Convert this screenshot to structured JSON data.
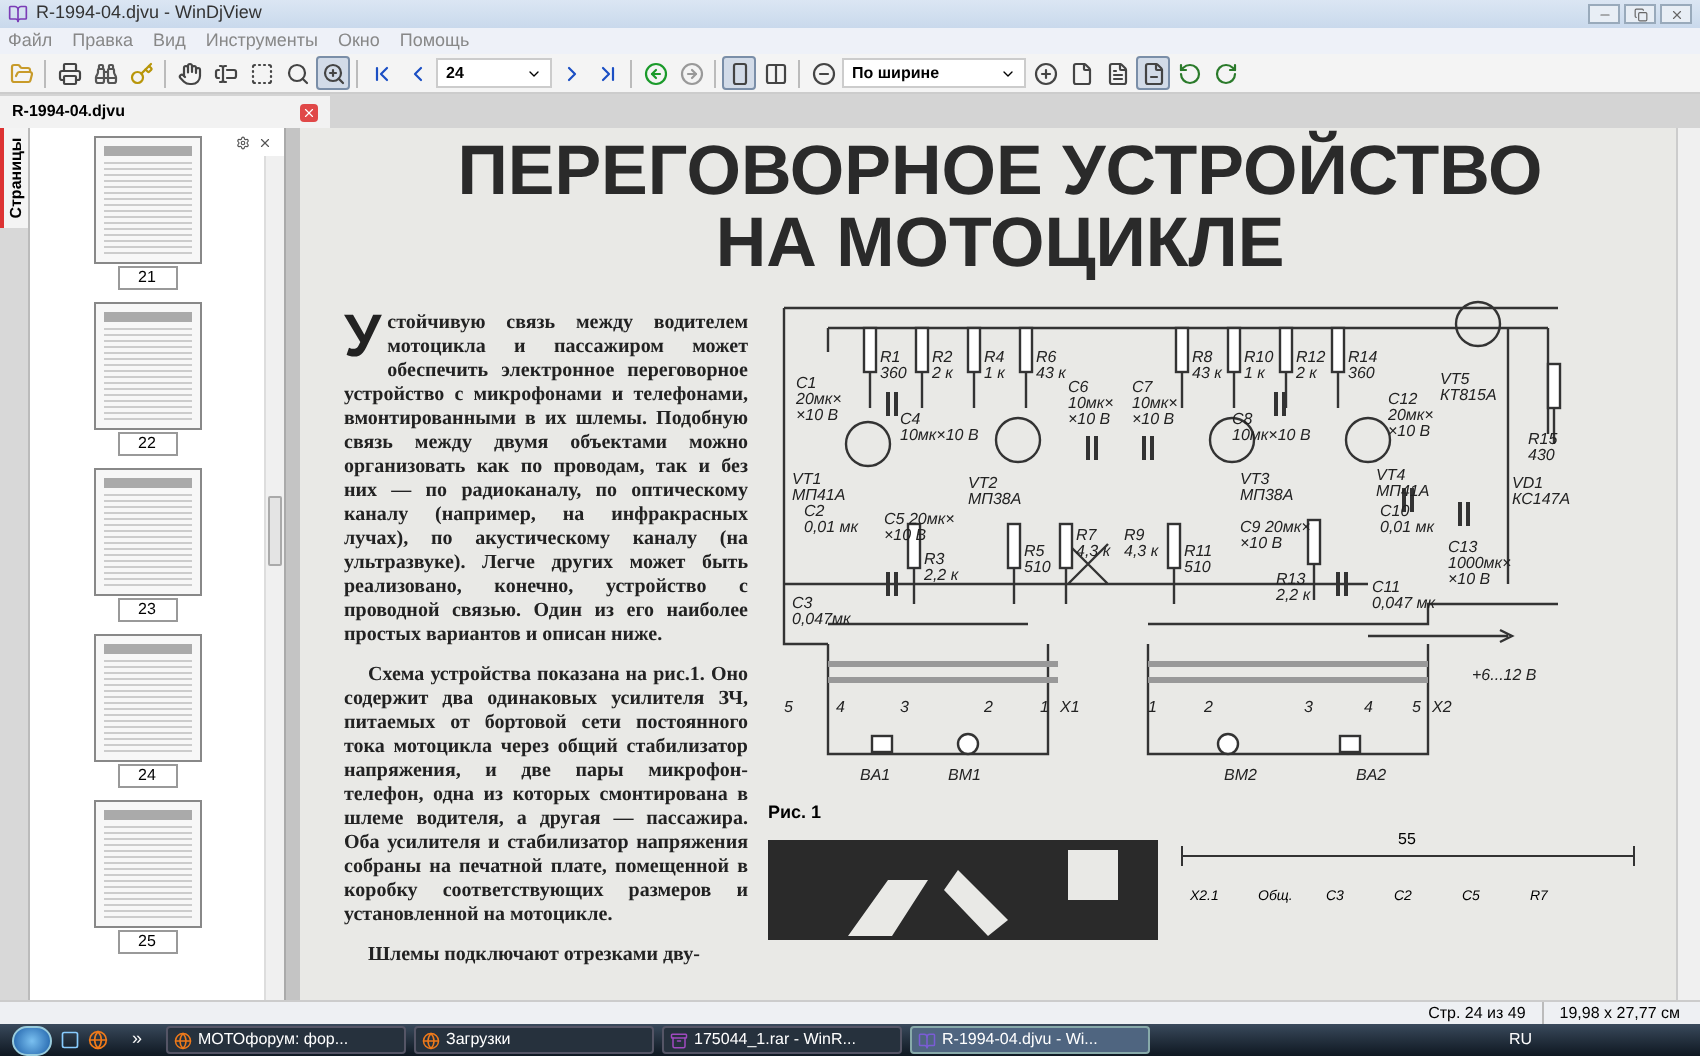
{
  "window": {
    "title": "R-1994-04.djvu - WinDjView"
  },
  "menu": [
    "Файл",
    "Правка",
    "Вид",
    "Инструменты",
    "Окно",
    "Помощь"
  ],
  "toolbar": [
    {
      "kind": "open",
      "selected": false
    },
    {
      "kind": "separator"
    },
    {
      "kind": "print",
      "selected": false
    },
    {
      "kind": "find",
      "selected": false
    },
    {
      "kind": "properties",
      "selected": false
    },
    {
      "kind": "separator"
    },
    {
      "kind": "hand",
      "selected": false
    },
    {
      "kind": "text-select",
      "selected": false
    },
    {
      "kind": "rect-select",
      "selected": false
    },
    {
      "kind": "zoom",
      "selected": false
    },
    {
      "kind": "zoom-rect",
      "selected": true
    },
    {
      "kind": "separator"
    },
    {
      "kind": "first",
      "selected": false
    },
    {
      "kind": "prev",
      "selected": false
    },
    {
      "kind": "page-field",
      "value": "24"
    },
    {
      "kind": "next",
      "selected": false
    },
    {
      "kind": "last",
      "selected": false
    },
    {
      "kind": "separator"
    },
    {
      "kind": "back",
      "selected": false
    },
    {
      "kind": "forward",
      "selected": false
    },
    {
      "kind": "separator"
    },
    {
      "kind": "single-page",
      "selected": true
    },
    {
      "kind": "two-pages",
      "selected": false
    },
    {
      "kind": "separator"
    },
    {
      "kind": "zoom-out",
      "selected": false
    },
    {
      "kind": "zoom-combo",
      "value": "По ширине"
    },
    {
      "kind": "zoom-in",
      "selected": false
    },
    {
      "kind": "fit-page",
      "selected": false
    },
    {
      "kind": "fit-width",
      "selected": false
    },
    {
      "kind": "actual-size",
      "selected": true
    },
    {
      "kind": "rotate-left",
      "selected": false
    },
    {
      "kind": "rotate-right",
      "selected": false
    }
  ],
  "document_tab": {
    "title": "R-1994-04.djvu"
  },
  "sidebar": {
    "tab": "Страницы",
    "thumbnails": [
      "21",
      "22",
      "23",
      "24",
      "25"
    ]
  },
  "article": {
    "title_lines": [
      "ПЕРЕГОВОРНОЕ УСТРОЙСТВО",
      "НА МОТОЦИКЛЕ"
    ],
    "drop_cap": "У",
    "paragraphs": [
      "стойчивую связь между водителем мотоцикла и пассажиром может обеспечить электронное переговорное устройство с микрофонами и телефонами, вмонтированными в их шлемы. Подобную связь между двумя объектами можно организовать как по проводам, так и без них — по радиоканалу, по оптическому каналу (например, на инфракрасных лучах), по акустическому каналу (на ультразвуке). Легче других может быть реализовано, конечно, устройство с проводной связью. Один из его наиболее простых вариантов и описан ниже.",
      "Схема устройства показана на рис.1. Оно содержит два одинаковых усилителя ЗЧ, питаемых от бортовой сети постоянного тока мотоцикла через общий стабилизатор напряжения, и две пары микрофон-телефон, одна из которых смонтирована в шлеме водителя, а другая — пассажира. Оба усилителя и стабилизатор напряжения собраны на печатной плате, помещенной в коробку соответствующих размеров и установленной на мотоцикле.",
      "Шлемы подключают отрезками дву-"
    ],
    "schematic_labels": [
      [
        "C1",
        "20мк×",
        "×10 В"
      ],
      [
        "R1",
        "360"
      ],
      [
        "R2",
        "2 к"
      ],
      [
        "R4",
        "1 к"
      ],
      [
        "R6",
        "43 к"
      ],
      [
        "C4",
        "10мк×10 В"
      ],
      [
        "VT2",
        "МП38А"
      ],
      [
        "C6",
        "10мк×",
        "×10 В"
      ],
      [
        "VT1",
        "МП41А"
      ],
      [
        "C2",
        "0,01 мк"
      ],
      [
        "C5 20мк×",
        "×10 В"
      ],
      [
        "R3",
        "2,2 к"
      ],
      [
        "R5",
        "510"
      ],
      [
        "R7",
        "4,3 к"
      ],
      [
        "C3",
        "0,047мк"
      ],
      [
        "C7",
        "10мк×",
        "×10 В"
      ],
      [
        "R8",
        "43 к"
      ],
      [
        "R10",
        "1 к"
      ],
      [
        "R12",
        "2 к"
      ],
      [
        "R14",
        "360"
      ],
      [
        "C8",
        "10мк×10 В"
      ],
      [
        "VT3",
        "МП38А"
      ],
      [
        "C12",
        "20мк×",
        "×10 В"
      ],
      [
        "VT5",
        "КТ815А"
      ],
      [
        "VT4",
        "МП41А"
      ],
      [
        "R15",
        "430"
      ],
      [
        "VD1",
        "КС147А"
      ],
      [
        "R9",
        "4,3 к"
      ],
      [
        "C9 20мк×",
        "×10 В"
      ],
      [
        "R11",
        "510"
      ],
      [
        "C10",
        "0,01 мк"
      ],
      [
        "R13",
        "2,2 к"
      ],
      [
        "C13",
        "1000мк×",
        "×10 В"
      ],
      [
        "C11",
        "0,047 мк"
      ],
      [
        "+6...12 В"
      ],
      [
        "5"
      ],
      [
        "4"
      ],
      [
        "3"
      ],
      [
        "2"
      ],
      [
        "1"
      ],
      [
        "X1"
      ],
      [
        "1"
      ],
      [
        "2"
      ],
      [
        "3"
      ],
      [
        "4"
      ],
      [
        "5"
      ],
      [
        "X2"
      ],
      [
        "BA1"
      ],
      [
        "BM1"
      ],
      [
        "BM2"
      ],
      [
        "BA2"
      ]
    ],
    "figure_caption": "Рис. 1",
    "board_labels": [
      "55",
      "X2.1",
      "Общ.",
      "C3",
      "C2",
      "C5",
      "R7"
    ]
  },
  "status_bar": {
    "page": "Стр. 24 из 49",
    "size": "19,98 x 27,77 см"
  },
  "taskbar": {
    "overflow": "»",
    "tasks": [
      {
        "kind": "browser",
        "label": "МОТОфорум: фор...",
        "selected": false
      },
      {
        "kind": "browser",
        "label": "Загрузки",
        "selected": false
      },
      {
        "kind": "archive",
        "label": "175044_1.rar - WinR...",
        "selected": false
      },
      {
        "kind": "viewer",
        "label": "R-1994-04.djvu - Wi...",
        "selected": true
      }
    ],
    "language": "RU"
  }
}
